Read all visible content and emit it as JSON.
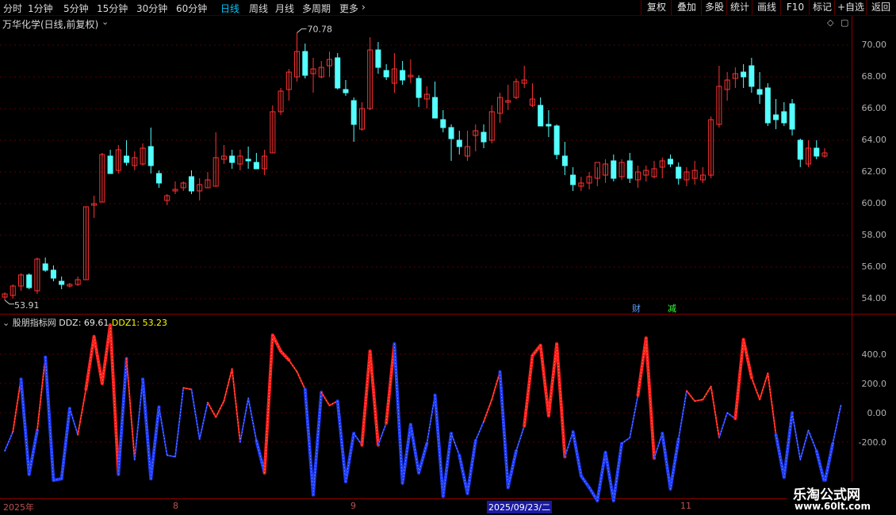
{
  "toolbar": {
    "periods": [
      "分时",
      "1分钟",
      "5分钟",
      "15分钟",
      "30分钟",
      "60分钟",
      "日线",
      "周线",
      "月线",
      "多周期",
      "更多"
    ],
    "more_arrow": "›",
    "right_buttons": [
      "复权",
      "叠加",
      "多股",
      "统计",
      "画线",
      "F10",
      "标记",
      "+自选",
      "返回"
    ]
  },
  "chart": {
    "title": "万华化学(日线,前复权)",
    "high_marker": "70.78",
    "low_marker": "53.91",
    "y_ticks": [
      "70.00",
      "68.00",
      "66.00",
      "64.00",
      "62.00",
      "60.00",
      "58.00",
      "56.00",
      "54.00"
    ],
    "tags": {
      "cai": "财",
      "jian": "减"
    }
  },
  "indicator": {
    "name": "股朋指标网",
    "ddz_label": "DDZ: 69.61",
    "ddz1_label": "DDZ1: 53.23",
    "y_ticks": [
      "400.0",
      "200.0",
      "0.00",
      "-200.0"
    ]
  },
  "xaxis": {
    "labels": [
      "2025年",
      "8",
      "9",
      "2025/09/23/二",
      "11"
    ]
  },
  "watermark": {
    "line1": "乐淘公式网",
    "line2": "www.60lt.com"
  },
  "colors": {
    "up": "#ff3232",
    "down": "#54ffff",
    "frame": "#8b0000",
    "ddz_pos": "#ff1e1e",
    "ddz_neg": "#1e3cff"
  },
  "chart_data": {
    "type": "candlestick",
    "price_range": [
      53.5,
      71.0
    ],
    "candles": [
      [
        54.1,
        54.4,
        53.91,
        54.3
      ],
      [
        54.2,
        54.9,
        54.0,
        54.8
      ],
      [
        54.8,
        55.6,
        54.5,
        55.5
      ],
      [
        55.5,
        55.6,
        54.6,
        54.7
      ],
      [
        54.5,
        56.6,
        54.3,
        56.5
      ],
      [
        56.2,
        56.6,
        55.7,
        55.8
      ],
      [
        55.8,
        56.1,
        55.1,
        55.3
      ],
      [
        55.1,
        55.4,
        54.6,
        54.9
      ],
      [
        54.8,
        55.0,
        54.7,
        54.9
      ],
      [
        54.9,
        55.4,
        54.8,
        55.2
      ],
      [
        55.2,
        59.8,
        55.2,
        59.8
      ],
      [
        59.9,
        60.5,
        59.1,
        60.0
      ],
      [
        60.1,
        63.2,
        60.1,
        63.1
      ],
      [
        63.0,
        63.4,
        61.9,
        61.9
      ],
      [
        62.1,
        63.7,
        61.9,
        63.4
      ],
      [
        63.0,
        64.0,
        62.4,
        62.6
      ],
      [
        62.4,
        63.3,
        62.1,
        62.9
      ],
      [
        62.5,
        63.8,
        62.4,
        63.5
      ],
      [
        63.6,
        64.8,
        61.9,
        62.4
      ],
      [
        61.9,
        62.1,
        61.0,
        61.3
      ],
      [
        60.2,
        60.6,
        59.9,
        60.5
      ],
      [
        60.8,
        61.4,
        60.6,
        60.9
      ],
      [
        61.0,
        61.4,
        60.8,
        61.3
      ],
      [
        61.7,
        62.1,
        60.6,
        60.8
      ],
      [
        60.8,
        61.6,
        60.2,
        61.2
      ],
      [
        61.0,
        62.0,
        61.0,
        61.5
      ],
      [
        61.1,
        64.5,
        61.1,
        62.9
      ],
      [
        62.8,
        63.7,
        62.5,
        63.0
      ],
      [
        63.0,
        63.4,
        62.2,
        62.6
      ],
      [
        62.5,
        63.4,
        62.1,
        63.0
      ],
      [
        62.8,
        63.6,
        62.2,
        62.7
      ],
      [
        62.6,
        63.2,
        62.2,
        62.2
      ],
      [
        62.2,
        63.4,
        61.8,
        63.0
      ],
      [
        63.2,
        66.2,
        63.2,
        65.8
      ],
      [
        65.8,
        67.3,
        65.6,
        67.1
      ],
      [
        67.2,
        68.5,
        66.5,
        68.3
      ],
      [
        68.0,
        70.78,
        67.7,
        69.6
      ],
      [
        69.6,
        70.1,
        67.9,
        68.1
      ],
      [
        68.2,
        69.2,
        67.0,
        68.5
      ],
      [
        68.0,
        69.0,
        67.9,
        68.6
      ],
      [
        68.7,
        69.6,
        68.0,
        69.1
      ],
      [
        69.2,
        69.5,
        67.2,
        67.3
      ],
      [
        67.2,
        67.8,
        66.8,
        67.0
      ],
      [
        66.5,
        66.7,
        63.9,
        65.0
      ],
      [
        64.7,
        66.4,
        64.6,
        66.0
      ],
      [
        66.0,
        70.5,
        65.9,
        69.7
      ],
      [
        69.7,
        70.2,
        68.2,
        68.6
      ],
      [
        68.4,
        68.8,
        67.8,
        68.0
      ],
      [
        67.6,
        69.5,
        67.0,
        68.5
      ],
      [
        68.4,
        69.0,
        67.5,
        67.8
      ],
      [
        68.0,
        69.1,
        67.6,
        68.1
      ],
      [
        67.9,
        68.1,
        66.1,
        66.7
      ],
      [
        66.6,
        67.4,
        66.0,
        66.9
      ],
      [
        66.7,
        67.7,
        65.4,
        65.4
      ],
      [
        65.3,
        65.9,
        64.5,
        64.8
      ],
      [
        64.8,
        65.0,
        62.7,
        64.1
      ],
      [
        64.0,
        64.6,
        63.1,
        63.6
      ],
      [
        63.0,
        64.6,
        62.7,
        63.6
      ],
      [
        64.3,
        65.0,
        63.3,
        64.6
      ],
      [
        64.5,
        65.0,
        63.5,
        63.9
      ],
      [
        64.0,
        66.2,
        63.8,
        65.8
      ],
      [
        65.7,
        67.0,
        65.1,
        66.7
      ],
      [
        66.4,
        67.5,
        65.9,
        66.5
      ],
      [
        66.7,
        67.9,
        66.6,
        67.7
      ],
      [
        67.6,
        68.7,
        67.3,
        67.8
      ],
      [
        66.2,
        67.6,
        66.1,
        66.6
      ],
      [
        66.2,
        66.7,
        64.9,
        64.9
      ],
      [
        65.0,
        65.9,
        64.2,
        64.9
      ],
      [
        64.9,
        65.0,
        62.8,
        63.1
      ],
      [
        63.0,
        63.9,
        61.8,
        62.4
      ],
      [
        61.8,
        62.3,
        60.8,
        61.2
      ],
      [
        61.1,
        61.7,
        60.8,
        61.3
      ],
      [
        61.3,
        62.0,
        60.9,
        61.7
      ],
      [
        61.6,
        62.3,
        61.1,
        62.6
      ],
      [
        61.8,
        62.8,
        61.3,
        62.5
      ],
      [
        62.7,
        63.1,
        61.4,
        61.6
      ],
      [
        61.7,
        62.8,
        61.5,
        62.6
      ],
      [
        62.7,
        63.2,
        61.3,
        61.6
      ],
      [
        61.5,
        62.4,
        61.0,
        62.0
      ],
      [
        61.8,
        62.4,
        61.4,
        62.1
      ],
      [
        61.7,
        62.7,
        61.6,
        62.2
      ],
      [
        62.3,
        62.9,
        61.6,
        62.7
      ],
      [
        62.8,
        63.1,
        62.3,
        62.5
      ],
      [
        62.3,
        62.6,
        61.2,
        61.6
      ],
      [
        61.5,
        62.3,
        61.1,
        62.0
      ],
      [
        61.6,
        62.7,
        61.2,
        62.1
      ],
      [
        61.5,
        62.3,
        61.3,
        61.8
      ],
      [
        61.8,
        65.5,
        61.6,
        65.3
      ],
      [
        65.0,
        68.7,
        64.8,
        67.4
      ],
      [
        67.2,
        68.3,
        66.5,
        67.8
      ],
      [
        67.9,
        68.6,
        67.3,
        68.2
      ],
      [
        68.3,
        68.8,
        67.3,
        68.0
      ],
      [
        68.7,
        69.2,
        67.0,
        67.4
      ],
      [
        67.2,
        68.3,
        66.3,
        66.9
      ],
      [
        67.3,
        67.6,
        64.9,
        65.1
      ],
      [
        65.6,
        66.6,
        64.7,
        65.3
      ],
      [
        65.8,
        66.4,
        64.9,
        65.1
      ],
      [
        66.3,
        66.6,
        64.3,
        64.7
      ],
      [
        64.0,
        64.1,
        62.3,
        62.8
      ],
      [
        62.5,
        64.0,
        62.3,
        63.5
      ],
      [
        63.5,
        64.0,
        62.8,
        63.0
      ],
      [
        63.0,
        63.5,
        62.9,
        63.2
      ]
    ],
    "ddz": [
      -260,
      -130,
      230,
      -420,
      -120,
      380,
      -460,
      -450,
      30,
      -150,
      160,
      520,
      200,
      600,
      -420,
      370,
      -320,
      230,
      -450,
      40,
      -290,
      -300,
      170,
      160,
      -180,
      70,
      -30,
      80,
      300,
      -200,
      100,
      -190,
      -410,
      530,
      420,
      360,
      280,
      160,
      -560,
      140,
      50,
      80,
      -470,
      -140,
      -220,
      420,
      -220,
      -70,
      470,
      -480,
      -80,
      -410,
      -210,
      120,
      -570,
      -140,
      -290,
      -550,
      -190,
      -60,
      90,
      280,
      -510,
      -260,
      -90,
      390,
      460,
      -20,
      470,
      -300,
      -130,
      -430,
      -510,
      -600,
      -270,
      -600,
      -210,
      -170,
      120,
      510,
      -310,
      -140,
      -520,
      -180,
      150,
      80,
      90,
      180,
      -170,
      0,
      -40,
      500,
      240,
      90,
      270,
      -150,
      -440,
      0,
      -320,
      -120,
      -260,
      -480,
      -210,
      50
    ]
  }
}
